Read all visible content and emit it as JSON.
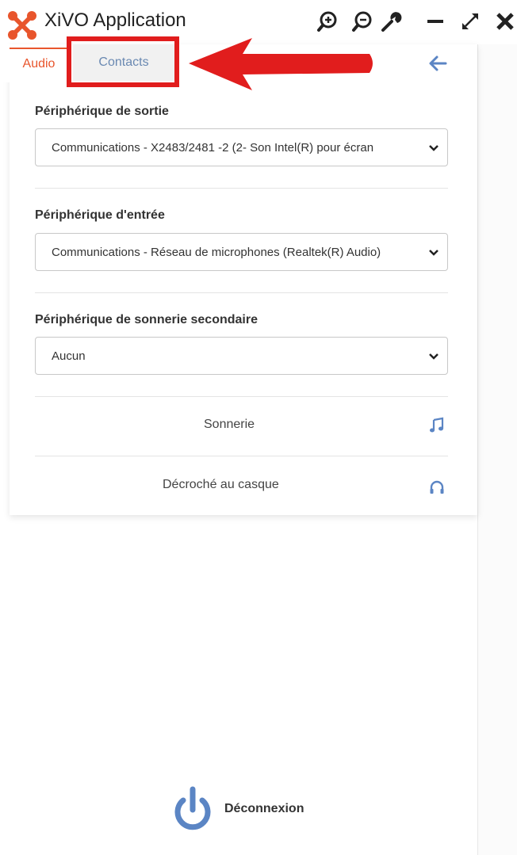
{
  "app": {
    "title": "XiVO Application",
    "logo_icon": "xivo-logo-icon",
    "brand_color": "#e8552c"
  },
  "window_controls": {
    "icons": [
      "zoom-in-icon",
      "zoom-out-icon",
      "wrench-icon",
      "minimize-icon",
      "maximize-icon",
      "close-icon"
    ]
  },
  "tabs": [
    {
      "label": "Audio",
      "active": true
    },
    {
      "label": "Contacts",
      "active": false
    }
  ],
  "annotation": {
    "highlight_color": "#e11d1d"
  },
  "audio": {
    "output": {
      "label": "Périphérique de sortie",
      "value": "Communications - X2483/2481 -2 (2- Son Intel(R) pour écran"
    },
    "input": {
      "label": "Périphérique d'entrée",
      "value": "Communications - Réseau de microphones (Realtek(R) Audio)"
    },
    "secondary_ring": {
      "label": "Périphérique de sonnerie secondaire",
      "value": "Aucun"
    },
    "ringtone": {
      "label": "Sonnerie",
      "icon": "music-note-icon"
    },
    "headset": {
      "label": "Décroché au casque",
      "icon": "headphones-icon"
    }
  },
  "logout": {
    "label": "Déconnexion",
    "icon": "power-icon"
  }
}
